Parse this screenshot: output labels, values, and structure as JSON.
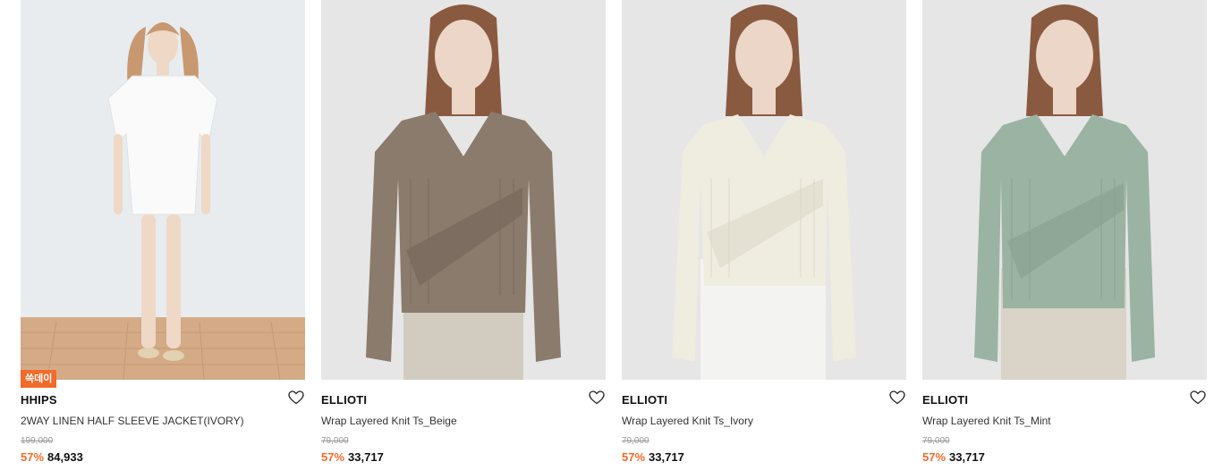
{
  "colors": {
    "accent": "#f26b2a",
    "bg": "#ffffff"
  },
  "products": [
    {
      "badge": "쓱데이",
      "brand": "HHIPS",
      "name": "2WAY LINEN HALF SLEEVE JACKET(IVORY)",
      "original_price": "199,000",
      "discount": "57%",
      "price": "84,933",
      "garment_color": "#f7f7f5"
    },
    {
      "badge": "",
      "brand": "ELLIOTI",
      "name": "Wrap Layered Knit Ts_Beige",
      "original_price": "79,000",
      "discount": "57%",
      "price": "33,717",
      "garment_color": "#8b7b6c"
    },
    {
      "badge": "",
      "brand": "ELLIOTI",
      "name": "Wrap Layered Knit Ts_Ivory",
      "original_price": "79,000",
      "discount": "57%",
      "price": "33,717",
      "garment_color": "#efece0"
    },
    {
      "badge": "",
      "brand": "ELLIOTI",
      "name": "Wrap Layered Knit Ts_Mint",
      "original_price": "79,000",
      "discount": "57%",
      "price": "33,717",
      "garment_color": "#9bb3a3"
    }
  ]
}
